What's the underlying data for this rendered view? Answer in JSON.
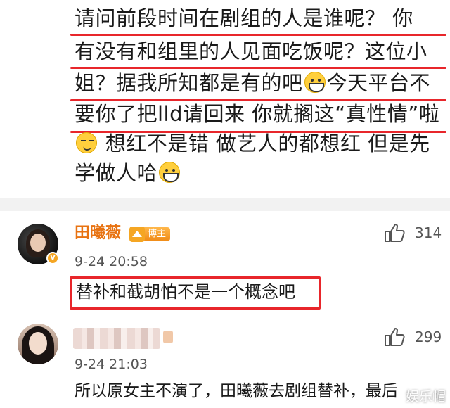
{
  "post": {
    "lines": [
      "请问前段时间在剧组的人是谁呢？ 你",
      "有没有和组里的人见面吃饭呢？这位小",
      "姐？据我所知都是有的吧",
      "今天平台不",
      "要你了把lld请回来 你就搁这“真性情”啦",
      "想红不是错 做艺人的都想红 但是先",
      "学做人哈"
    ]
  },
  "comments": [
    {
      "username": "田曦薇",
      "badge": "博主",
      "time": "9-24 20:58",
      "likes": "314",
      "text": "替补和截胡怕不是一个概念吧"
    },
    {
      "username": "",
      "time": "9-24 21:03",
      "likes": "299",
      "text": "所以原女主不演了，田曦薇去剧组替补，最后"
    }
  ],
  "watermark": "娱乐帽",
  "icons": {
    "emoji_grin": "grin-emoji-icon",
    "emoji_smirk": "smirk-emoji-icon",
    "like": "thumbs-up-icon",
    "verified": "verified-v-icon",
    "crown": "crown-icon"
  },
  "colors": {
    "highlight_red": "#e8262b",
    "username_orange": "#e87312",
    "badge_gold": "#f5a623"
  }
}
